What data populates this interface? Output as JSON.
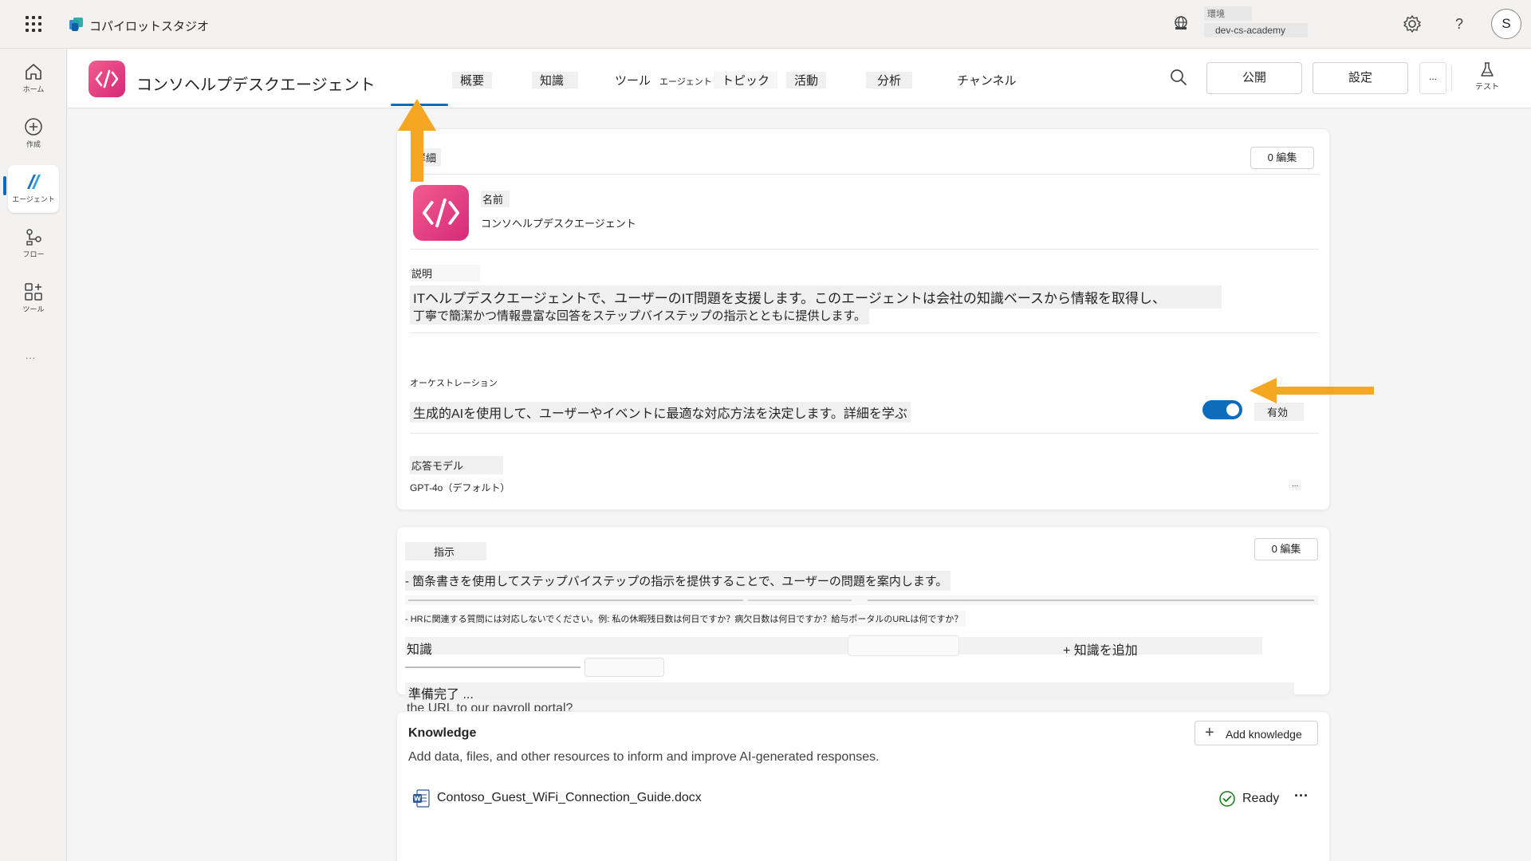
{
  "app": {
    "name": "コパイロットスタジオ",
    "environment_label": "環境",
    "environment_value": "dev-cs-academy",
    "avatar_initial": "S",
    "help_glyph": "?"
  },
  "rail": {
    "items": [
      {
        "label": "ホーム",
        "icon": "home-icon"
      },
      {
        "label": "作成",
        "icon": "plus-circle-icon"
      },
      {
        "label": "エージェント",
        "icon": "agent-icon"
      },
      {
        "label": "フロー",
        "icon": "flow-icon"
      },
      {
        "label": "ツール",
        "icon": "tools-icon"
      }
    ],
    "more": "..."
  },
  "header": {
    "agent_name": "コンソヘルプデスクエージェント",
    "tabs": [
      {
        "label": "概要",
        "active": true
      },
      {
        "label": "知識"
      },
      {
        "label": "ツール"
      },
      {
        "label": "エージェント"
      },
      {
        "label": "トピック"
      },
      {
        "label": "活動"
      },
      {
        "label": "分析"
      },
      {
        "label": "チャンネル"
      }
    ],
    "publish_label": "公開",
    "settings_label": "設定",
    "more_label": "...",
    "test_label": "テスト"
  },
  "details": {
    "section_label": "詳細",
    "edit_label": "0 編集",
    "name_label": "名前",
    "name_value": "コンソヘルプデスクエージェント",
    "description_label": "説明",
    "description_line1": "ITヘルプデスクエージェントで、ユーザーのIT問題を支援します。このエージェントは会社の知識ベースから情報を取得し、",
    "description_line2": "丁寧で簡潔かつ情報豊富な回答をステップバイステップの指示とともに提供します。",
    "orchestration_label": "オーケストレーション",
    "orchestration_text": "生成的AIを使用して、ユーザーやイベントに最適な対応方法を決定します。詳細を学ぶ",
    "orchestration_state": "有効",
    "model_label": "応答モデル",
    "model_value": "GPT-4o（デフォルト）",
    "model_more": "..."
  },
  "instructions": {
    "section_label": "指示",
    "edit_label": "0 編集",
    "line1": "- 箇条書きを使用してステップバイステップの指示を提供することで、ユーザーの問題を案内します。",
    "line3": "- HRに関連する質問には対応しないでください。例: 私の休暇残日数は何日ですか？病欠日数は何日ですか？給与ポータルのURLは何ですか？",
    "knowledge_label": "知識",
    "add_knowledge": "+ 知識を追加",
    "ready": "準備完了 ...",
    "trailing": "the URL to our payroll portal?"
  },
  "knowledge": {
    "title": "Knowledge",
    "add_button": "Add knowledge",
    "description": "Add data, files, and other resources to inform and improve AI-generated responses.",
    "files": [
      {
        "name": "Contoso_Guest_WiFi_Connection_Guide.docx",
        "status": "Ready",
        "more": "···"
      }
    ]
  },
  "colors": {
    "accent": "#0f6cbd",
    "agent_icon": "#e4397f",
    "annotation_arrow": "#f5a623",
    "ready_green": "#107c10"
  }
}
